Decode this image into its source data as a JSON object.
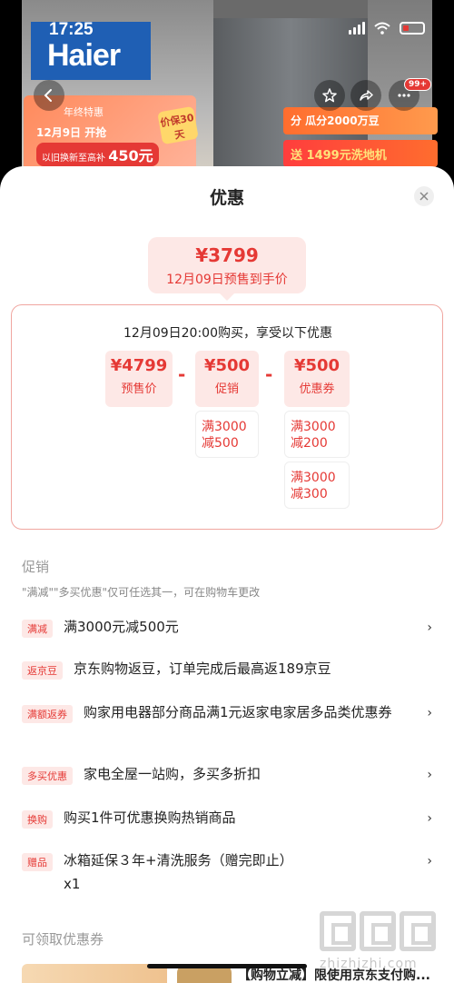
{
  "status_bar": {
    "time": "17:25"
  },
  "hero": {
    "brand": "Haier",
    "promo_left": {
      "line1": "年终特惠",
      "line2_prefix": "12月9日",
      "line2_suffix": "开抢",
      "line3_prefix": "以旧换新至高补",
      "line3_price": "450元"
    },
    "promo_badge": "价保30天",
    "promo_right": {
      "r1": "分  瓜分2000万豆",
      "r2": "送 1499元洗地机"
    },
    "more_badge": "99+"
  },
  "sheet": {
    "title": "优惠",
    "final": {
      "price": "¥3799",
      "label": "12月09日预售到手价"
    },
    "calc": {
      "heading": "12月09日20:00购买，享受以下优惠",
      "presale": {
        "amount": "¥4799",
        "label": "预售价"
      },
      "minus": "-",
      "promo": {
        "amount": "¥500",
        "label": "促销"
      },
      "coupon": {
        "amount": "¥500",
        "label": "优惠券"
      },
      "promo_detail": {
        "line1": "满3000",
        "line2": "减500"
      },
      "coupon_detail_1": {
        "line1": "满3000",
        "line2": "减200"
      },
      "coupon_detail_2": {
        "line1": "满3000",
        "line2": "减300"
      }
    },
    "promotions": {
      "title": "促销",
      "note": "\"满减\"\"多买优惠\"仅可任选其一，可在购物车更改",
      "rows": [
        {
          "tag": "满减",
          "text": "满3000元减500元"
        },
        {
          "tag": "返京豆",
          "text": "京东购物返豆，订单完成后最高返189京豆"
        },
        {
          "tag": "满额返券",
          "text": "购家用电器部分商品满1元返家电家居多品类优惠券"
        },
        {
          "tag": "多买优惠",
          "text": "家电全屋一站购，多买多折扣"
        },
        {
          "tag": "换购",
          "text": "购买1件可优惠换购热销商品"
        },
        {
          "tag": "赠品",
          "text": "冰箱延保３年+清洗服务（赠完即止）",
          "qty": "x1"
        }
      ]
    },
    "coupons": {
      "title": "可领取优惠券",
      "partial_text": "【购物立减】限使用京东支付购..."
    },
    "watermark": {
      "site": "zhizhizhi.com"
    }
  },
  "icons": [
    "back-icon",
    "star-icon",
    "share-icon",
    "more-icon",
    "close-icon",
    "chevron-right-icon",
    "signal-icon",
    "wifi-icon",
    "battery-icon"
  ]
}
